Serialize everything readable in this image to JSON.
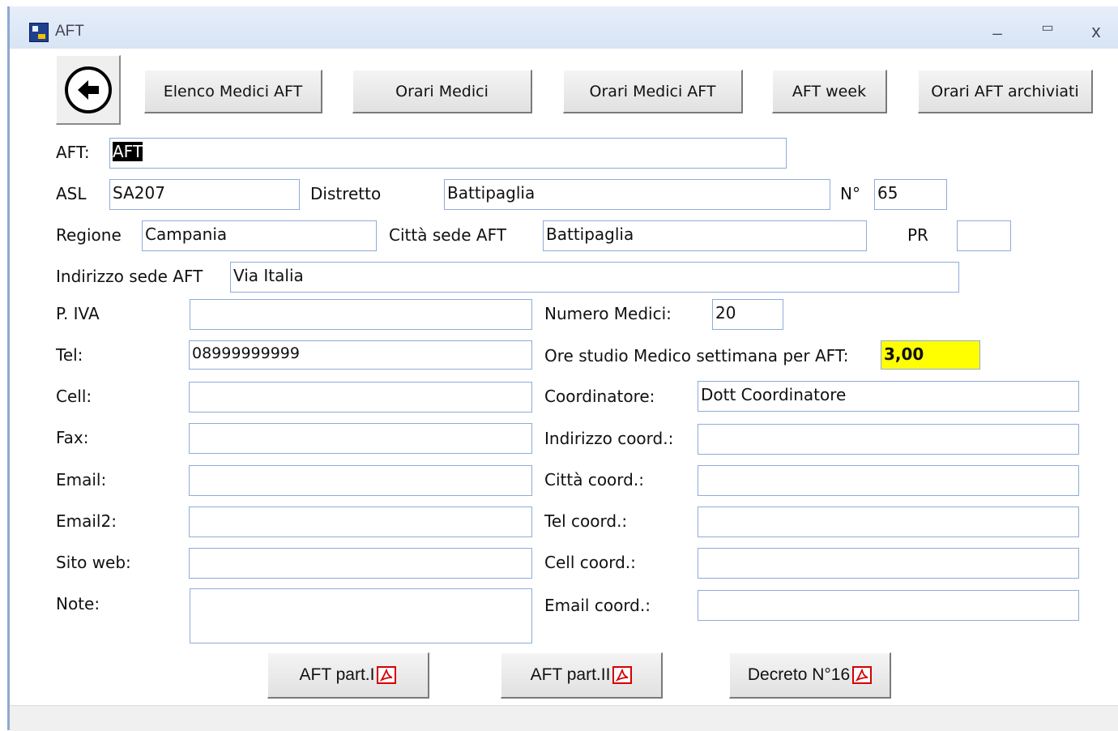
{
  "window": {
    "title": "AFT"
  },
  "toolbar": {
    "elenco_medici_aft": "Elenco Medici AFT",
    "orari_medici": "Orari Medici",
    "orari_medici_aft": "Orari Medici AFT",
    "aft_week": "AFT week",
    "orari_aft_archiviati": "Orari AFT archiviati"
  },
  "form": {
    "aft": {
      "label": "AFT:",
      "value": "AFT"
    },
    "asl": {
      "label": "ASL",
      "value": "SA207"
    },
    "distretto": {
      "label": "Distretto",
      "value": "Battipaglia"
    },
    "numero": {
      "label": "N°",
      "value": "65"
    },
    "regione": {
      "label": "Regione",
      "value": "Campania"
    },
    "citta_sede": {
      "label": "Città sede AFT",
      "value": "Battipaglia"
    },
    "pr": {
      "label": "PR",
      "value": ""
    },
    "indirizzo_sede": {
      "label": "Indirizzo sede AFT",
      "value": "Via Italia"
    },
    "piva": {
      "label": "P. IVA",
      "value": ""
    },
    "tel": {
      "label": "Tel:",
      "value": "08999999999"
    },
    "cell": {
      "label": "Cell:",
      "value": ""
    },
    "fax": {
      "label": "Fax:",
      "value": ""
    },
    "email": {
      "label": "Email:",
      "value": ""
    },
    "email2": {
      "label": "Email2:",
      "value": ""
    },
    "sito_web": {
      "label": "Sito web:",
      "value": ""
    },
    "note": {
      "label": "Note:",
      "value": ""
    },
    "numero_medici": {
      "label": "Numero Medici:",
      "value": "20"
    },
    "ore_studio": {
      "label": "Ore studio Medico settimana per AFT:",
      "value": "3,00",
      "highlight_color": "#ffff00"
    },
    "coordinatore": {
      "label": "Coordinatore:",
      "value": "Dott Coordinatore"
    },
    "indirizzo_coord": {
      "label": "Indirizzo coord.:",
      "value": ""
    },
    "citta_coord": {
      "label": "Città coord.:",
      "value": ""
    },
    "tel_coord": {
      "label": "Tel coord.:",
      "value": ""
    },
    "cell_coord": {
      "label": "Cell coord.:",
      "value": ""
    },
    "email_coord": {
      "label": "Email coord.:",
      "value": ""
    }
  },
  "bottom_buttons": {
    "aft_part1": "AFT part.I",
    "aft_part2": "AFT part.II",
    "decreto": "Decreto N°16",
    "icon": "pdf-icon"
  },
  "colors": {
    "field_border": "#8eacd9",
    "titlebar": "#dfe8f6"
  }
}
